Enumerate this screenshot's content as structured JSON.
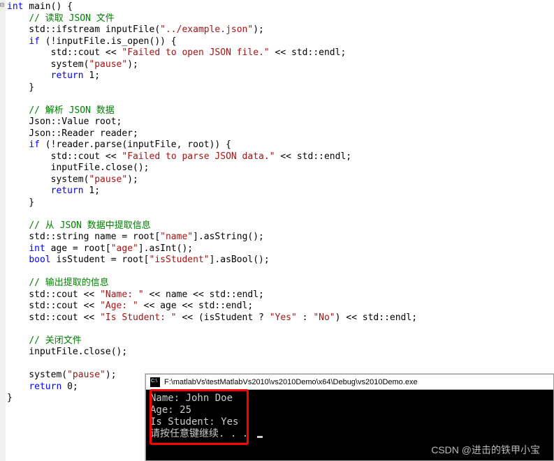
{
  "code": {
    "sig_kw1": "int",
    "sig_name": " main() {",
    "c1": "// 读取 JSON 文件",
    "l2a": "    std::ifstream inputFile(",
    "l2s": "\"../example.json\"",
    "l2b": ");",
    "l3a": "    ",
    "l3kw": "if",
    "l3b": " (!inputFile.is_open()) {",
    "l4a": "        std::cout << ",
    "l4s": "\"Failed to open JSON file.\"",
    "l4b": " << std::endl;",
    "l5a": "        system(",
    "l5s": "\"pause\"",
    "l5b": ");",
    "l6a": "        ",
    "l6kw": "return",
    "l6b": " 1;",
    "l7": "    }",
    "blank": "",
    "c2": "// 解析 JSON 数据",
    "l9": "    Json::Value root;",
    "l10": "    Json::Reader reader;",
    "l11a": "    ",
    "l11kw": "if",
    "l11b": " (!reader.parse(inputFile, root)) {",
    "l12a": "        std::cout << ",
    "l12s": "\"Failed to parse JSON data.\"",
    "l12b": " << std::endl;",
    "l13": "        inputFile.close();",
    "l14a": "        system(",
    "l14s": "\"pause\"",
    "l14b": ");",
    "l15a": "        ",
    "l15kw": "return",
    "l15b": " 1;",
    "l16": "    }",
    "c3": "// 从 JSON 数据中提取信息",
    "l18a": "    std::string name = root[",
    "l18s": "\"name\"",
    "l18b": "].asString();",
    "l19a": "    ",
    "l19kw": "int",
    "l19b": " age = root[",
    "l19s": "\"age\"",
    "l19c": "].asInt();",
    "l20a": "    ",
    "l20kw": "bool",
    "l20b": " isStudent = root[",
    "l20s": "\"isStudent\"",
    "l20c": "].asBool();",
    "c4": "// 输出提取的信息",
    "l22a": "    std::cout << ",
    "l22s": "\"Name: \"",
    "l22b": " << name << std::endl;",
    "l23a": "    std::cout << ",
    "l23s": "\"Age: \"",
    "l23b": " << age << std::endl;",
    "l24a": "    std::cout << ",
    "l24s": "\"Is Student: \"",
    "l24b": " << (isStudent ? ",
    "l24s2": "\"Yes\"",
    "l24c": " : ",
    "l24s3": "\"No\"",
    "l24d": ") << std::endl;",
    "c5": "// 关闭文件",
    "l26": "    inputFile.close();",
    "l27a": "    system(",
    "l27s": "\"pause\"",
    "l27b": ");",
    "l28a": "    ",
    "l28kw": "return",
    "l28b": " 0;",
    "l29": "}"
  },
  "console": {
    "title": "F:\\matlabVs\\testMatlabVs2010\\vs2010Demo\\x64\\Debug\\vs2010Demo.exe",
    "line1": "Name: John Doe",
    "line2": "Age: 25",
    "line3": "Is Student: Yes",
    "line4": "请按任意键继续. . . "
  },
  "watermark": "CSDN @进击的铁甲小宝"
}
